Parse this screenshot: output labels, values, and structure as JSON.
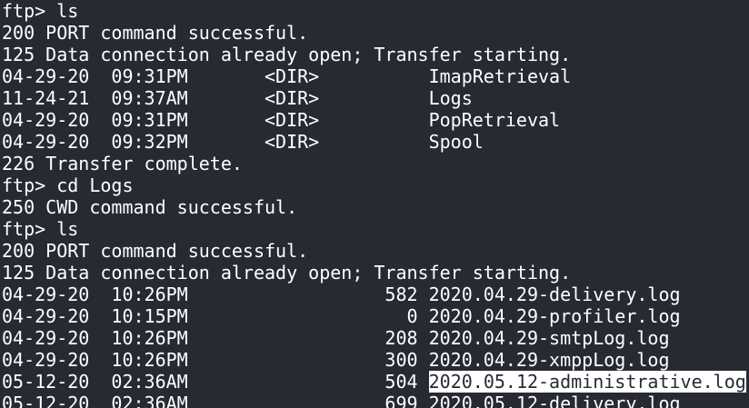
{
  "terminal": {
    "lines": [
      "ftp> ls",
      "200 PORT command successful.",
      "125 Data connection already open; Transfer starting.",
      "04-29-20  09:31PM       <DIR>          ImapRetrieval",
      "11-24-21  09:37AM       <DIR>          Logs",
      "04-29-20  09:31PM       <DIR>          PopRetrieval",
      "04-29-20  09:32PM       <DIR>          Spool",
      "226 Transfer complete.",
      "ftp> cd Logs",
      "250 CWD command successful.",
      "ftp> ls",
      "200 PORT command successful.",
      "125 Data connection already open; Transfer starting.",
      "04-29-20  10:26PM                  582 2020.04.29-delivery.log",
      "04-29-20  10:15PM                    0 2020.04.29-profiler.log",
      "04-29-20  10:26PM                  208 2020.04.29-smtpLog.log",
      "04-29-20  10:26PM                  300 2020.04.29-xmppLog.log"
    ],
    "highlighted_line": {
      "prefix": "05-12-20  02:36AM                  504 ",
      "selected": "2020.05.12-administrative.log"
    },
    "last_line": "05-12-20  02:36AM                  699 2020.05.12-delivery.log"
  },
  "colors": {
    "background": "#272a33",
    "text": "#ffffff",
    "selection_bg": "#ffffff",
    "selection_fg": "#272a33"
  }
}
